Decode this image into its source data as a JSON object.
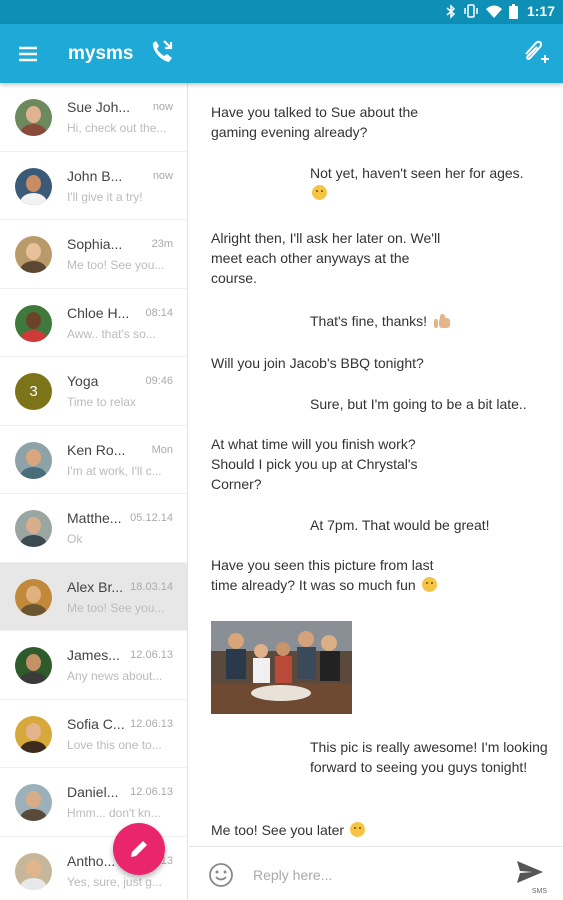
{
  "status_bar": {
    "time": "1:17",
    "icons": [
      "bluetooth-icon",
      "vibrate-icon",
      "wifi-icon",
      "battery-icon"
    ]
  },
  "app_bar": {
    "title": "mysms",
    "colors": {
      "bar": "#1fa9d6",
      "status": "#0e8fb6",
      "fab": "#e9266b"
    }
  },
  "conversations": [
    {
      "name": "Sue Joh...",
      "time": "now",
      "preview": "Hi, check out the..."
    },
    {
      "name": "John B...",
      "time": "now",
      "preview": "I'll give it a try!"
    },
    {
      "name": "Sophia...",
      "time": "23m",
      "preview": "Me too! See you..."
    },
    {
      "name": "Chloe H...",
      "time": "08:14",
      "preview": "Aww.. that's so..."
    },
    {
      "name": "Yoga",
      "time": "09:46",
      "preview": "Time to relax",
      "avatar_text": "3"
    },
    {
      "name": "Ken Ro...",
      "time": "Mon",
      "preview": "I'm at work, I'll c..."
    },
    {
      "name": "Matthe...",
      "time": "05.12.14",
      "preview": "Ok"
    },
    {
      "name": "Alex Br...",
      "time": "18.03.14",
      "preview": "Me too! See you..."
    },
    {
      "name": "James...",
      "time": "12.06.13",
      "preview": "Any news about..."
    },
    {
      "name": "Sofia C...",
      "time": "12.06.13",
      "preview": "Love this one to..."
    },
    {
      "name": "Daniel...",
      "time": "12.06.13",
      "preview": "Hmm... don't kn..."
    },
    {
      "name": "Antho...",
      "time": "12.06.13",
      "preview": "Yes, sure, just g..."
    }
  ],
  "messages": [
    {
      "direction": "in",
      "text": "Have you talked to Sue about the gaming evening already?"
    },
    {
      "direction": "out",
      "text": "Not yet, haven't seen her for ages.",
      "emoji": "sad-face-icon"
    },
    {
      "direction": "in",
      "text": "Alright then, I'll ask her later on. We'll meet each other anyways at the course."
    },
    {
      "direction": "out",
      "text": "That's fine, thanks!",
      "emoji": "thumbs-up-icon"
    },
    {
      "direction": "in",
      "text": "Will you join Jacob's BBQ tonight?"
    },
    {
      "direction": "out",
      "text": "Sure, but I'm going to be a bit late.."
    },
    {
      "direction": "in",
      "text": "At what time will you finish work? Should I pick you up at Chrystal's Corner?"
    },
    {
      "direction": "out",
      "text": "At 7pm. That would be great!"
    },
    {
      "direction": "in",
      "text": "Have you seen this picture from last time already? It was so much fun",
      "emoji": "smile-face-icon",
      "image": "group-photo"
    },
    {
      "direction": "out",
      "text": "This pic is really awesome! I'm looking forward to seeing you guys tonight!"
    },
    {
      "direction": "in",
      "text": "Me too! See you later",
      "emoji": "smile-face-icon"
    }
  ],
  "reply": {
    "placeholder": "Reply here...",
    "send_label": "SMS"
  }
}
